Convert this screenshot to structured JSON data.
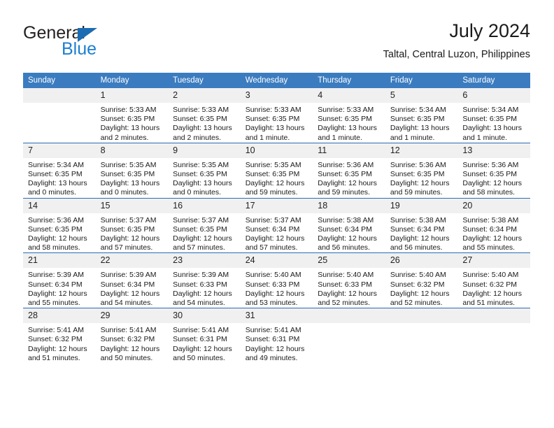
{
  "brand": {
    "name_part1": "General",
    "name_part2": "Blue",
    "triangle_icon": "triangle-icon",
    "colors": {
      "dark": "#231f20",
      "blue": "#1c7fd1",
      "triangle": "#1c6cb3"
    }
  },
  "header": {
    "title": "July 2024",
    "subtitle": "Taltal, Central Luzon, Philippines"
  },
  "theme": {
    "header_bg": "#3b7cc0",
    "header_text": "#ffffff",
    "row_divider": "#2a6db5",
    "daynum_bg": "#f0f0f0",
    "body_text": "#1a1a1a"
  },
  "calendar": {
    "weekday_headers": [
      "Sunday",
      "Monday",
      "Tuesday",
      "Wednesday",
      "Thursday",
      "Friday",
      "Saturday"
    ],
    "weeks": [
      [
        {
          "empty": true
        },
        {
          "day": "1",
          "sunrise": "Sunrise: 5:33 AM",
          "sunset": "Sunset: 6:35 PM",
          "daylight_line1": "Daylight: 13 hours",
          "daylight_line2": "and 2 minutes."
        },
        {
          "day": "2",
          "sunrise": "Sunrise: 5:33 AM",
          "sunset": "Sunset: 6:35 PM",
          "daylight_line1": "Daylight: 13 hours",
          "daylight_line2": "and 2 minutes."
        },
        {
          "day": "3",
          "sunrise": "Sunrise: 5:33 AM",
          "sunset": "Sunset: 6:35 PM",
          "daylight_line1": "Daylight: 13 hours",
          "daylight_line2": "and 1 minute."
        },
        {
          "day": "4",
          "sunrise": "Sunrise: 5:33 AM",
          "sunset": "Sunset: 6:35 PM",
          "daylight_line1": "Daylight: 13 hours",
          "daylight_line2": "and 1 minute."
        },
        {
          "day": "5",
          "sunrise": "Sunrise: 5:34 AM",
          "sunset": "Sunset: 6:35 PM",
          "daylight_line1": "Daylight: 13 hours",
          "daylight_line2": "and 1 minute."
        },
        {
          "day": "6",
          "sunrise": "Sunrise: 5:34 AM",
          "sunset": "Sunset: 6:35 PM",
          "daylight_line1": "Daylight: 13 hours",
          "daylight_line2": "and 1 minute."
        }
      ],
      [
        {
          "day": "7",
          "sunrise": "Sunrise: 5:34 AM",
          "sunset": "Sunset: 6:35 PM",
          "daylight_line1": "Daylight: 13 hours",
          "daylight_line2": "and 0 minutes."
        },
        {
          "day": "8",
          "sunrise": "Sunrise: 5:35 AM",
          "sunset": "Sunset: 6:35 PM",
          "daylight_line1": "Daylight: 13 hours",
          "daylight_line2": "and 0 minutes."
        },
        {
          "day": "9",
          "sunrise": "Sunrise: 5:35 AM",
          "sunset": "Sunset: 6:35 PM",
          "daylight_line1": "Daylight: 13 hours",
          "daylight_line2": "and 0 minutes."
        },
        {
          "day": "10",
          "sunrise": "Sunrise: 5:35 AM",
          "sunset": "Sunset: 6:35 PM",
          "daylight_line1": "Daylight: 12 hours",
          "daylight_line2": "and 59 minutes."
        },
        {
          "day": "11",
          "sunrise": "Sunrise: 5:36 AM",
          "sunset": "Sunset: 6:35 PM",
          "daylight_line1": "Daylight: 12 hours",
          "daylight_line2": "and 59 minutes."
        },
        {
          "day": "12",
          "sunrise": "Sunrise: 5:36 AM",
          "sunset": "Sunset: 6:35 PM",
          "daylight_line1": "Daylight: 12 hours",
          "daylight_line2": "and 59 minutes."
        },
        {
          "day": "13",
          "sunrise": "Sunrise: 5:36 AM",
          "sunset": "Sunset: 6:35 PM",
          "daylight_line1": "Daylight: 12 hours",
          "daylight_line2": "and 58 minutes."
        }
      ],
      [
        {
          "day": "14",
          "sunrise": "Sunrise: 5:36 AM",
          "sunset": "Sunset: 6:35 PM",
          "daylight_line1": "Daylight: 12 hours",
          "daylight_line2": "and 58 minutes."
        },
        {
          "day": "15",
          "sunrise": "Sunrise: 5:37 AM",
          "sunset": "Sunset: 6:35 PM",
          "daylight_line1": "Daylight: 12 hours",
          "daylight_line2": "and 57 minutes."
        },
        {
          "day": "16",
          "sunrise": "Sunrise: 5:37 AM",
          "sunset": "Sunset: 6:35 PM",
          "daylight_line1": "Daylight: 12 hours",
          "daylight_line2": "and 57 minutes."
        },
        {
          "day": "17",
          "sunrise": "Sunrise: 5:37 AM",
          "sunset": "Sunset: 6:34 PM",
          "daylight_line1": "Daylight: 12 hours",
          "daylight_line2": "and 57 minutes."
        },
        {
          "day": "18",
          "sunrise": "Sunrise: 5:38 AM",
          "sunset": "Sunset: 6:34 PM",
          "daylight_line1": "Daylight: 12 hours",
          "daylight_line2": "and 56 minutes."
        },
        {
          "day": "19",
          "sunrise": "Sunrise: 5:38 AM",
          "sunset": "Sunset: 6:34 PM",
          "daylight_line1": "Daylight: 12 hours",
          "daylight_line2": "and 56 minutes."
        },
        {
          "day": "20",
          "sunrise": "Sunrise: 5:38 AM",
          "sunset": "Sunset: 6:34 PM",
          "daylight_line1": "Daylight: 12 hours",
          "daylight_line2": "and 55 minutes."
        }
      ],
      [
        {
          "day": "21",
          "sunrise": "Sunrise: 5:39 AM",
          "sunset": "Sunset: 6:34 PM",
          "daylight_line1": "Daylight: 12 hours",
          "daylight_line2": "and 55 minutes."
        },
        {
          "day": "22",
          "sunrise": "Sunrise: 5:39 AM",
          "sunset": "Sunset: 6:34 PM",
          "daylight_line1": "Daylight: 12 hours",
          "daylight_line2": "and 54 minutes."
        },
        {
          "day": "23",
          "sunrise": "Sunrise: 5:39 AM",
          "sunset": "Sunset: 6:33 PM",
          "daylight_line1": "Daylight: 12 hours",
          "daylight_line2": "and 54 minutes."
        },
        {
          "day": "24",
          "sunrise": "Sunrise: 5:40 AM",
          "sunset": "Sunset: 6:33 PM",
          "daylight_line1": "Daylight: 12 hours",
          "daylight_line2": "and 53 minutes."
        },
        {
          "day": "25",
          "sunrise": "Sunrise: 5:40 AM",
          "sunset": "Sunset: 6:33 PM",
          "daylight_line1": "Daylight: 12 hours",
          "daylight_line2": "and 52 minutes."
        },
        {
          "day": "26",
          "sunrise": "Sunrise: 5:40 AM",
          "sunset": "Sunset: 6:32 PM",
          "daylight_line1": "Daylight: 12 hours",
          "daylight_line2": "and 52 minutes."
        },
        {
          "day": "27",
          "sunrise": "Sunrise: 5:40 AM",
          "sunset": "Sunset: 6:32 PM",
          "daylight_line1": "Daylight: 12 hours",
          "daylight_line2": "and 51 minutes."
        }
      ],
      [
        {
          "day": "28",
          "sunrise": "Sunrise: 5:41 AM",
          "sunset": "Sunset: 6:32 PM",
          "daylight_line1": "Daylight: 12 hours",
          "daylight_line2": "and 51 minutes."
        },
        {
          "day": "29",
          "sunrise": "Sunrise: 5:41 AM",
          "sunset": "Sunset: 6:32 PM",
          "daylight_line1": "Daylight: 12 hours",
          "daylight_line2": "and 50 minutes."
        },
        {
          "day": "30",
          "sunrise": "Sunrise: 5:41 AM",
          "sunset": "Sunset: 6:31 PM",
          "daylight_line1": "Daylight: 12 hours",
          "daylight_line2": "and 50 minutes."
        },
        {
          "day": "31",
          "sunrise": "Sunrise: 5:41 AM",
          "sunset": "Sunset: 6:31 PM",
          "daylight_line1": "Daylight: 12 hours",
          "daylight_line2": "and 49 minutes."
        },
        {
          "empty": true
        },
        {
          "empty": true
        },
        {
          "empty": true
        }
      ]
    ]
  }
}
